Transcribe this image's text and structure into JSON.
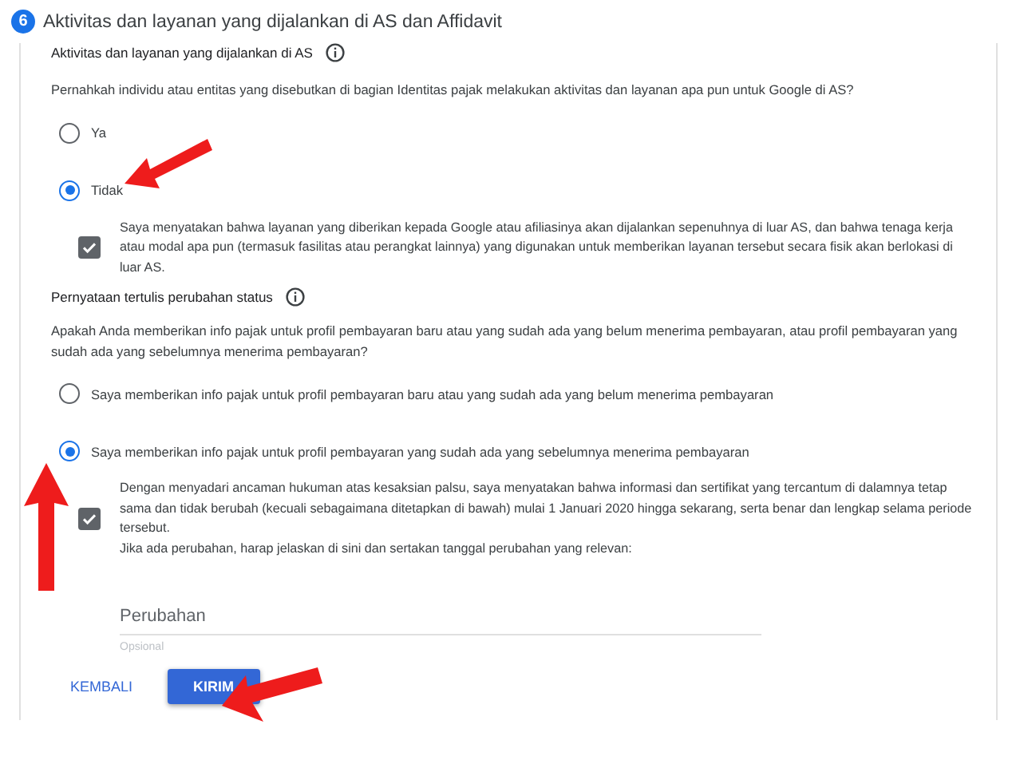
{
  "step": {
    "number": "6",
    "title": "Aktivitas dan layanan yang dijalankan di AS dan Affidavit"
  },
  "sections": [
    {
      "heading": "Aktivitas dan layanan yang dijalankan di AS",
      "question": "Pernahkah individu atau entitas yang disebutkan di bagian Identitas pajak melakukan aktivitas dan layanan apa pun untuk Google di AS?",
      "options": [
        {
          "label": "Ya",
          "selected": false
        },
        {
          "label": "Tidak",
          "selected": true
        }
      ],
      "declaration": {
        "checked": true,
        "lines": [
          "Saya menyatakan bahwa layanan yang diberikan kepada Google atau afiliasinya akan dijalankan sepenuhnya di luar AS, dan bahwa tenaga kerja atau modal apa pun (termasuk fasilitas atau perangkat lainnya) yang digunakan untuk memberikan layanan tersebut secara fisik akan berlokasi di luar AS."
        ]
      }
    },
    {
      "heading": "Pernyataan tertulis perubahan status",
      "question": "Apakah Anda memberikan info pajak untuk profil pembayaran baru atau yang sudah ada yang belum menerima pembayaran, atau profil pembayaran yang sudah ada yang sebelumnya menerima pembayaran?",
      "options": [
        {
          "label": "Saya memberikan info pajak untuk profil pembayaran baru atau yang sudah ada yang belum menerima pembayaran",
          "selected": false
        },
        {
          "label": "Saya memberikan info pajak untuk profil pembayaran yang sudah ada yang sebelumnya menerima pembayaran",
          "selected": true
        }
      ],
      "declaration": {
        "checked": true,
        "lines": [
          "Dengan menyadari ancaman hukuman atas kesaksian palsu, saya menyatakan bahwa informasi dan sertifikat yang tercantum di dalamnya tetap sama dan tidak berubah (kecuali sebagaimana ditetapkan di bawah) mulai 1 Januari 2020 hingga sekarang, serta benar dan lengkap selama periode tersebut.",
          "Jika ada perubahan, harap jelaskan di sini dan sertakan tanggal perubahan yang relevan:"
        ]
      },
      "field": {
        "placeholder": "Perubahan",
        "hint": "Opsional"
      }
    }
  ],
  "buttons": [
    {
      "label": "KEMBALI",
      "kind": "text"
    },
    {
      "label": "KIRIM",
      "kind": "raised"
    }
  ]
}
